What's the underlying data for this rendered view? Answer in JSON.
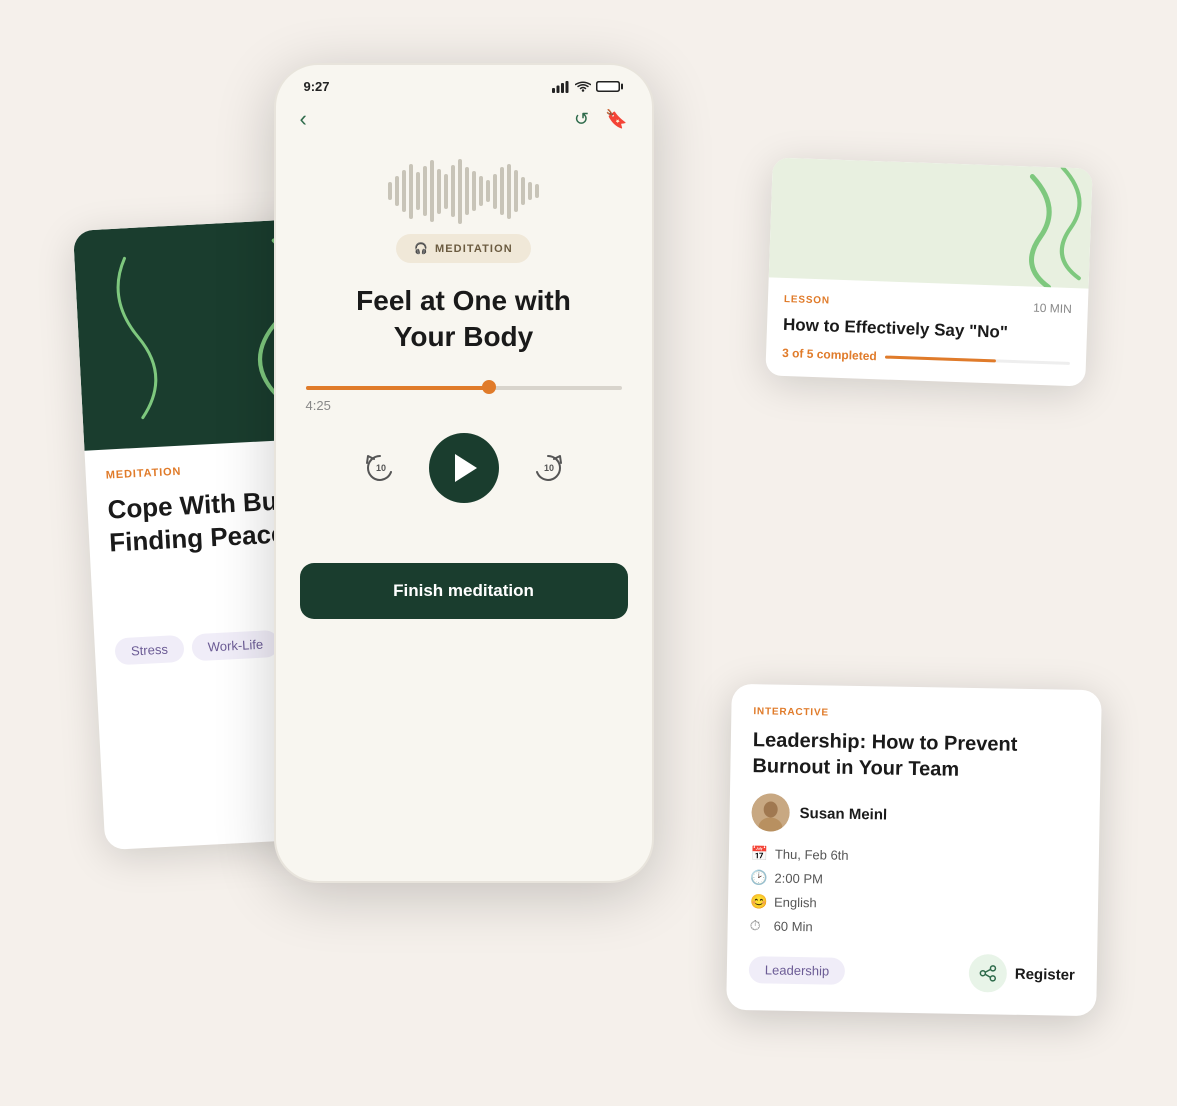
{
  "phone": {
    "time": "9:27",
    "back_label": "‹",
    "meditation_badge": "MEDITATION",
    "title_line1": "Feel at One with",
    "title_line2": "Your Body",
    "progress_time": "4:25",
    "finish_label": "Finish meditation"
  },
  "card_left": {
    "tag": "MEDITATION",
    "title": "Cope With Burnout: Finding Peace i...",
    "tag1": "Stress",
    "tag2": "Work-Life"
  },
  "card_lesson": {
    "tag": "LESSON",
    "duration": "10 MIN",
    "title": "How to Effectively Say \"No\"",
    "progress_text": "3 of 5  completed"
  },
  "card_interactive": {
    "tag": "INTERACTIVE",
    "title": "Leadership: How to Prevent Burnout in Your Team",
    "author": "Susan Meinl",
    "date": "Thu, Feb 6th",
    "time": "2:00 PM",
    "language": "English",
    "duration": "60 Min",
    "tag_label": "Leadership",
    "register_label": "Register"
  }
}
